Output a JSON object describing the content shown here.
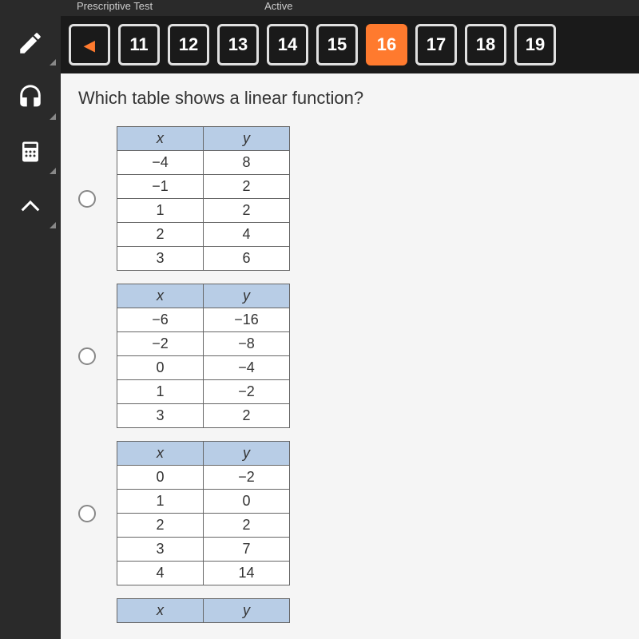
{
  "header": {
    "left": "Prescriptive Test",
    "right": "Active"
  },
  "nav": {
    "arrow": "◂",
    "items": [
      "11",
      "12",
      "13",
      "14",
      "15",
      "16",
      "17",
      "18",
      "19"
    ],
    "active": "16"
  },
  "question": "Which table shows a linear function?",
  "tables": [
    {
      "x_label": "x",
      "y_label": "y",
      "rows": [
        [
          "−4",
          "8"
        ],
        [
          "−1",
          "2"
        ],
        [
          "1",
          "2"
        ],
        [
          "2",
          "4"
        ],
        [
          "3",
          "6"
        ]
      ]
    },
    {
      "x_label": "x",
      "y_label": "y",
      "rows": [
        [
          "−6",
          "−16"
        ],
        [
          "−2",
          "−8"
        ],
        [
          "0",
          "−4"
        ],
        [
          "1",
          "−2"
        ],
        [
          "3",
          "2"
        ]
      ]
    },
    {
      "x_label": "x",
      "y_label": "y",
      "rows": [
        [
          "0",
          "−2"
        ],
        [
          "1",
          "0"
        ],
        [
          "2",
          "2"
        ],
        [
          "3",
          "7"
        ],
        [
          "4",
          "14"
        ]
      ]
    },
    {
      "x_label": "x",
      "y_label": "y",
      "rows": []
    }
  ],
  "tools": {
    "pencil": "pencil-icon",
    "headphones": "headphones-icon",
    "calculator": "calculator-icon",
    "caret": "caret-up-icon"
  }
}
